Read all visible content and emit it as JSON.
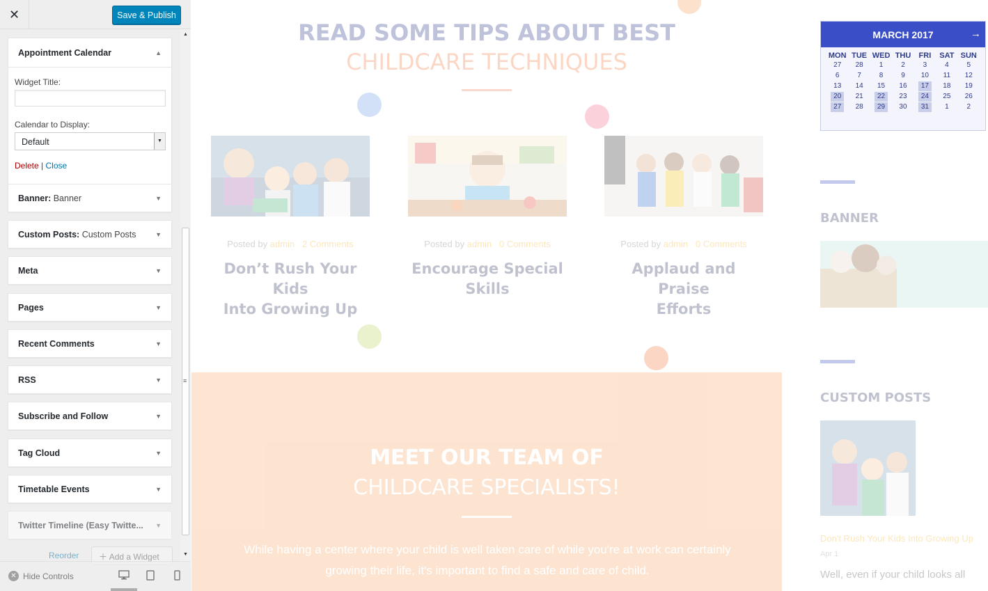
{
  "customizer": {
    "save_label": "Save & Publish",
    "close_glyph": "✕",
    "open_widget": {
      "title": "Appointment Calendar",
      "widget_title_label": "Widget Title:",
      "widget_title_value": "",
      "calendar_label": "Calendar to Display:",
      "calendar_value": "Default",
      "delete_label": "Delete",
      "separator": "|",
      "close_label": "Close"
    },
    "widgets": [
      {
        "title": "Banner:",
        "subtitle": "Banner"
      },
      {
        "title": "Custom Posts:",
        "subtitle": "Custom Posts"
      },
      {
        "title": "Meta",
        "subtitle": ""
      },
      {
        "title": "Pages",
        "subtitle": ""
      },
      {
        "title": "Recent Comments",
        "subtitle": ""
      },
      {
        "title": "RSS",
        "subtitle": ""
      },
      {
        "title": "Subscribe and Follow",
        "subtitle": ""
      },
      {
        "title": "Tag Cloud",
        "subtitle": ""
      },
      {
        "title": "Timetable Events",
        "subtitle": ""
      },
      {
        "title": "Twitter Timeline (Easy Twitte...",
        "subtitle": ""
      }
    ],
    "reorder_label": "Reorder",
    "add_widget_label": "Add a Widget",
    "hide_controls_label": "Hide Controls"
  },
  "preview": {
    "tips_title_1": "READ SOME TIPS ABOUT BEST",
    "tips_title_2": "CHILDCARE TECHNIQUES",
    "posts": [
      {
        "posted_by": "Posted by",
        "author": "admin",
        "comments": "2 Comments",
        "title_1": "Don’t Rush Your Kids",
        "title_2": "Into Growing Up"
      },
      {
        "posted_by": "Posted by",
        "author": "admin",
        "comments": "0 Comments",
        "title_1": "Encourage Special",
        "title_2": "Skills"
      },
      {
        "posted_by": "Posted by",
        "author": "admin",
        "comments": "0 Comments",
        "title_1": "Applaud and Praise",
        "title_2": "Efforts"
      }
    ],
    "team_title_1": "MEET OUR TEAM OF",
    "team_title_2": "CHILDCARE SPECIALISTS!",
    "team_text_1": "While having a center where your child is well taken care of while you're at work can certainly",
    "team_text_2": "growing their life, it's important to find a safe and care of child.",
    "calendar": {
      "month": "MARCH 2017",
      "next_glyph": "🡒",
      "days_of_week": [
        "MON",
        "TUE",
        "WED",
        "THU",
        "FRI",
        "SAT",
        "SUN"
      ],
      "weeks": [
        [
          "27",
          "28",
          "1",
          "2",
          "3",
          "4",
          "5"
        ],
        [
          "6",
          "7",
          "8",
          "9",
          "10",
          "11",
          "12"
        ],
        [
          "13",
          "14",
          "15",
          "16",
          "17",
          "18",
          "19"
        ],
        [
          "20",
          "21",
          "22",
          "23",
          "24",
          "25",
          "26"
        ],
        [
          "27",
          "28",
          "29",
          "30",
          "31",
          "1",
          "2"
        ]
      ]
    },
    "banner_heading": "BANNER",
    "custom_posts_heading": "CUSTOM POSTS",
    "custom_post_link": "Don't Rush Your Kids Into Growing Up",
    "custom_post_sub": "Apr 1",
    "custom_post_excerpt": "Well, even if your child looks all"
  },
  "colors": {
    "primary_button": "#0085ba",
    "theme_navy": "#2d3a8c",
    "theme_orange": "#f47b3e",
    "theme_yellow": "#f5b021"
  }
}
